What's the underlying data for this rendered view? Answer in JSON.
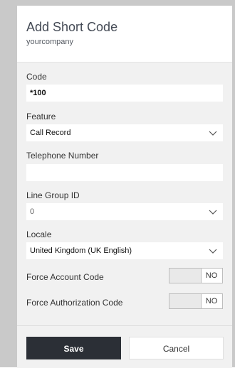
{
  "dialog": {
    "title": "Add Short Code",
    "subtitle": "yourcompany"
  },
  "form": {
    "code": {
      "label": "Code",
      "value": "*100"
    },
    "feature": {
      "label": "Feature",
      "value": "Call Record"
    },
    "telephone_number": {
      "label": "Telephone Number",
      "value": ""
    },
    "line_group_id": {
      "label": "Line Group ID",
      "value": "0"
    },
    "locale": {
      "label": "Locale",
      "value": "United Kingdom (UK English)"
    },
    "force_account_code": {
      "label": "Force Account Code",
      "state": "NO"
    },
    "force_authorization_code": {
      "label": "Force Authorization Code",
      "state": "NO"
    }
  },
  "footer": {
    "save_label": "Save",
    "cancel_label": "Cancel"
  },
  "icons": {
    "dropdown": "chevron-down-icon"
  },
  "colors": {
    "primary_button": "#2b2f36",
    "body_background": "#f1f1f1"
  }
}
